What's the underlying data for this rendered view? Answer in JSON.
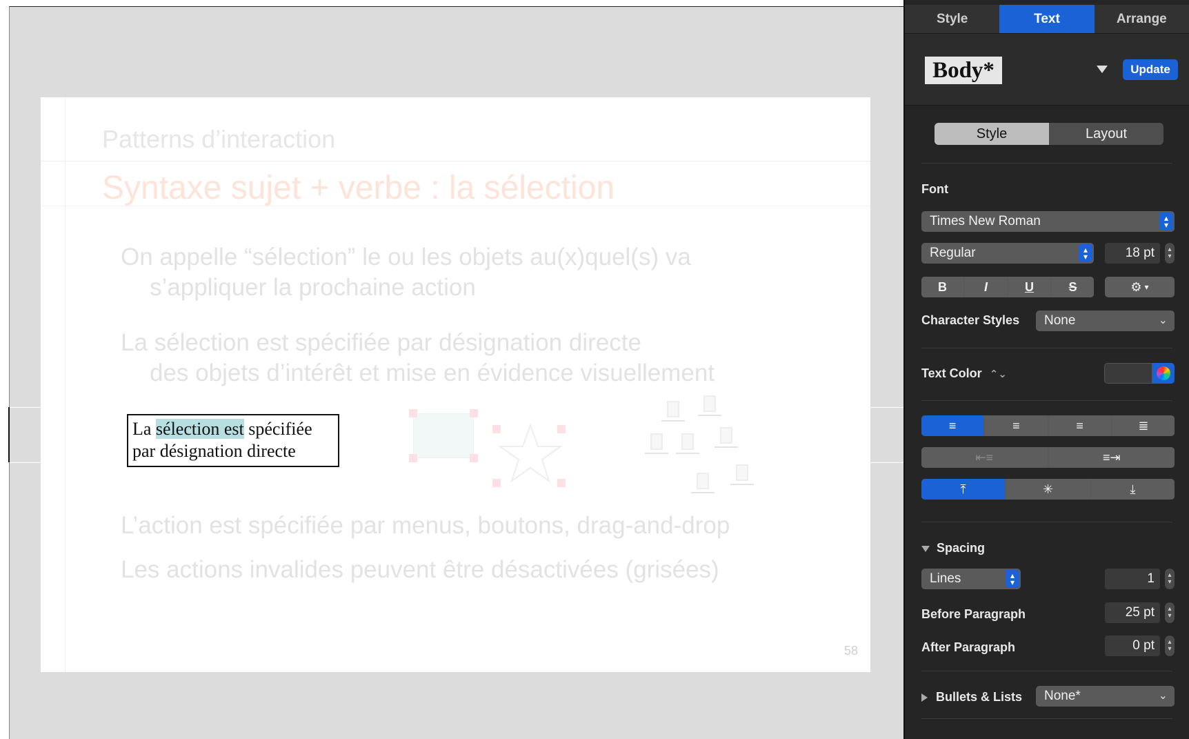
{
  "slide": {
    "header": "Patterns d’interaction",
    "title": "Syntaxe sujet + verbe : la sélection",
    "bullets": [
      {
        "line1": "On appelle “sélection” le ou les objets au(x)quel(s) va",
        "line2": "s’appliquer la prochaine action"
      },
      {
        "line1": "La sélection est spécifiée par désignation directe",
        "line2": "des objets d’intérêt et mise en évidence visuellement"
      },
      {
        "line1": "L’action est spécifiée par menus, boutons, drag-and-drop"
      },
      {
        "line1": "Les actions invalides peuvent être désactivées (grisées)"
      }
    ],
    "example": {
      "before": "La ",
      "highlight": "sélection est",
      "after": " spécifiée",
      "line2": "par désignation directe"
    },
    "page_number": "58"
  },
  "inspector": {
    "tabs": [
      {
        "label": "Style",
        "active": false
      },
      {
        "label": "Text",
        "active": true
      },
      {
        "label": "Arrange",
        "active": false
      }
    ],
    "paragraph_style": "Body*",
    "update_label": "Update",
    "segments": [
      {
        "label": "Style",
        "active": true
      },
      {
        "label": "Layout",
        "active": false
      }
    ],
    "font_label": "Font",
    "font_family": "Times New Roman",
    "font_typeface": "Regular",
    "font_size": "18 pt",
    "format_buttons": [
      "B",
      "I",
      "U",
      "S"
    ],
    "gear": "⚙",
    "character_styles_label": "Character Styles",
    "character_styles_value": "None",
    "text_color_label": "Text Color",
    "spacing_label": "Spacing",
    "spacing_mode": "Lines",
    "spacing_value": "1",
    "before_paragraph_label": "Before Paragraph",
    "before_paragraph_value": "25 pt",
    "after_paragraph_label": "After Paragraph",
    "after_paragraph_value": "0 pt",
    "bullets_label": "Bullets & Lists",
    "bullets_value": "None*"
  },
  "colors": {
    "accent": "#1a62d6",
    "inspector_bg": "#252525",
    "canvas_bg": "#dcdcdc",
    "selection_highlight": "#b7dfe2",
    "title_faded": "#fde3d8"
  }
}
